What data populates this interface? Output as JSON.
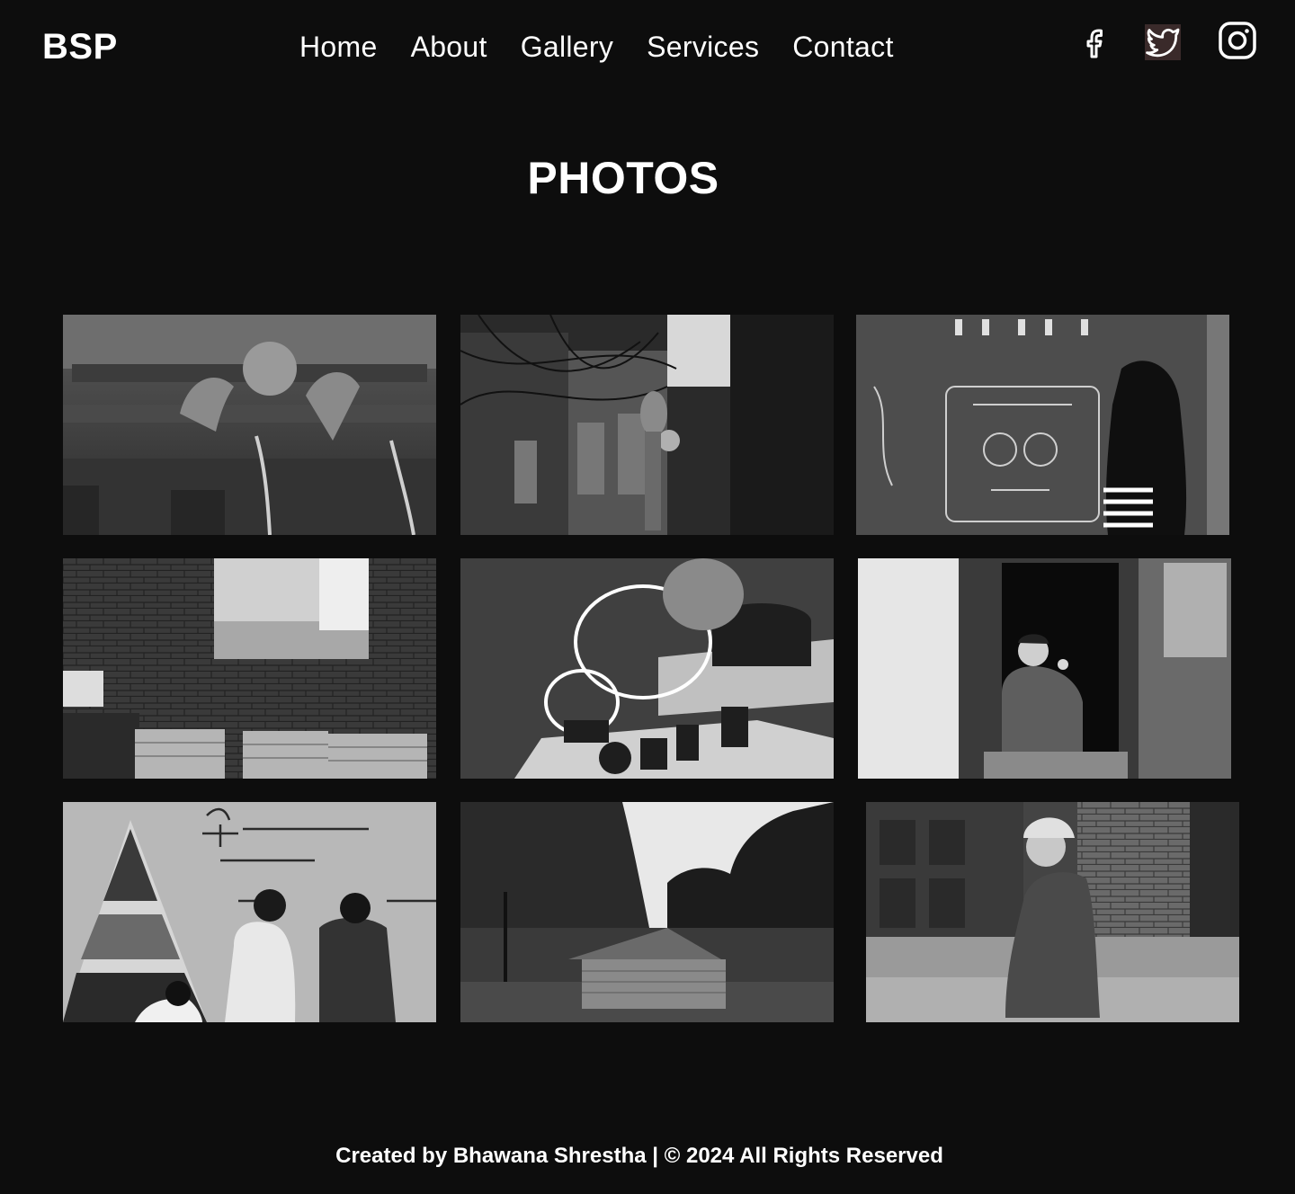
{
  "brand": {
    "logo_text": "BSP"
  },
  "nav": {
    "items": [
      {
        "label": "Home"
      },
      {
        "label": "About"
      },
      {
        "label": "Gallery"
      },
      {
        "label": "Services"
      },
      {
        "label": "Contact"
      }
    ]
  },
  "social": {
    "icons": [
      "facebook-icon",
      "twitter-icon",
      "instagram-icon"
    ]
  },
  "gallery": {
    "title": "PHOTOS",
    "photos": [
      "temple-water-spouts-photo",
      "electrician-alley-photo",
      "girl-wall-mural-photo",
      "brick-wall-office-photo",
      "ring-lamp-display-photo",
      "smiling-child-window-photo",
      "pyramid-mural-wall-photo",
      "forest-hut-photo",
      "elderly-woman-steps-photo"
    ],
    "style": "black-and-white"
  },
  "footer": {
    "text": "Created by Bhawana Shrestha | © 2024 All Rights Reserved"
  },
  "colors": {
    "background": "#0d0d0d",
    "text": "#ffffff"
  }
}
